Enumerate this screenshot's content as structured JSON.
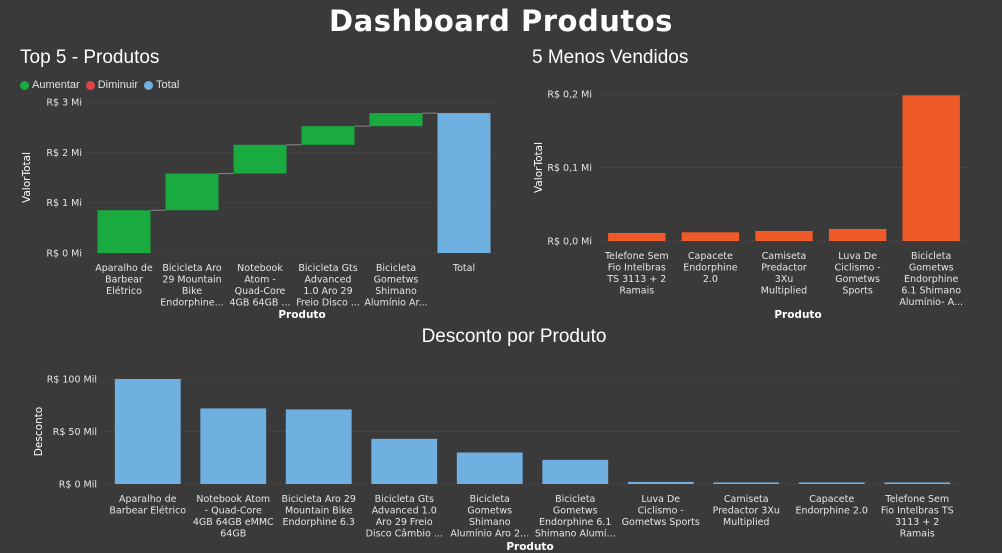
{
  "page_title": "Dashboard Produtos",
  "colors": {
    "increase": "#1aab40",
    "decrease": "#e0414b",
    "total": "#6fb0e0",
    "bottom": "#f05a28",
    "grid": "#5a5a5a"
  },
  "chart_data": [
    {
      "type": "bar",
      "subtype": "waterfall",
      "title": "Top 5 - Produtos",
      "xlabel": "Produto",
      "ylabel": "ValorTotal",
      "ylim": [
        0,
        3
      ],
      "yticks": [
        "R$ 0 Mi",
        "R$ 1 Mi",
        "R$ 2 Mi",
        "R$ 3 Mi"
      ],
      "legend": [
        {
          "label": "Aumentar",
          "color": "#1aab40"
        },
        {
          "label": "Diminuir",
          "color": "#e0414b"
        },
        {
          "label": "Total",
          "color": "#6fb0e0"
        }
      ],
      "legend_position": "top-left",
      "categories": [
        [
          "Aparalho de",
          "Barbear",
          "Elétrico"
        ],
        [
          "Bicicleta Aro",
          "29 Mountain",
          "Bike",
          "Endorphine..."
        ],
        [
          "Notebook",
          "Atom -",
          "Quad-Core",
          "4GB 64GB ..."
        ],
        [
          "Bicicleta Gts",
          "Advanced",
          "1.0 Aro 29",
          "Freio Disco ..."
        ],
        [
          "Bicicleta",
          "Gometws",
          "Shimano",
          "Alumínio Ar..."
        ],
        [
          "Total"
        ]
      ],
      "values": [
        0.85,
        0.73,
        0.57,
        0.37,
        0.26,
        2.78
      ],
      "kinds": [
        "increase",
        "increase",
        "increase",
        "increase",
        "increase",
        "total"
      ]
    },
    {
      "type": "bar",
      "title": "5 Menos Vendidos",
      "xlabel": "Produto",
      "ylabel": "ValorTotal",
      "ylim": [
        0,
        0.22
      ],
      "yticks": [
        "R$ 0,0 Mi",
        "R$ 0,1 Mi",
        "R$ 0,2 Mi"
      ],
      "categories": [
        [
          "Telefone Sem",
          "Fio Intelbras",
          "TS 3113 + 2",
          "Ramais"
        ],
        [
          "Capacete",
          "Endorphine",
          "2.0"
        ],
        [
          "Camiseta",
          "Predactor",
          "3Xu",
          "Multiplied"
        ],
        [
          "Luva De",
          "Ciclismo -",
          "Gometws",
          "Sports"
        ],
        [
          "Bicicleta",
          "Gometws",
          "Endorphine",
          "6.1 Shimano",
          "Alumínio- A..."
        ]
      ],
      "values": [
        0.012,
        0.013,
        0.015,
        0.018,
        0.218
      ]
    },
    {
      "type": "bar",
      "title": "Desconto por Produto",
      "xlabel": "Produto",
      "ylabel": "Desconto",
      "ylim": [
        0,
        100
      ],
      "yticks": [
        "R$ 0 Mil",
        "R$ 50 Mil",
        "R$ 100 Mil"
      ],
      "categories": [
        [
          "Aparalho de",
          "Barbear Elétrico"
        ],
        [
          "Notebook Atom",
          "- Quad-Core",
          "4GB 64GB eMMC",
          "64GB"
        ],
        [
          "Bicicleta Aro 29",
          "Mountain Bike",
          "Endorphine 6.3"
        ],
        [
          "Bicicleta Gts",
          "Advanced 1.0",
          "Aro 29 Freio",
          "Disco Câmbio ..."
        ],
        [
          "Bicicleta",
          "Gometws",
          "Shimano",
          "Alumínio Aro 2..."
        ],
        [
          "Bicicleta",
          "Gometws",
          "Endorphine 6.1",
          "Shimano Alumí..."
        ],
        [
          "Luva De",
          "Ciclismo -",
          "Gometws Sports"
        ],
        [
          "Camiseta",
          "Predactor 3Xu",
          "Multiplied"
        ],
        [
          "Capacete",
          "Endorphine 2.0"
        ],
        [
          "Telefone Sem",
          "Fio Intelbras TS",
          "3113 + 2",
          "Ramais"
        ]
      ],
      "values": [
        100,
        72,
        71,
        43,
        30,
        23,
        2,
        1.5,
        1.5,
        1.5
      ]
    }
  ]
}
